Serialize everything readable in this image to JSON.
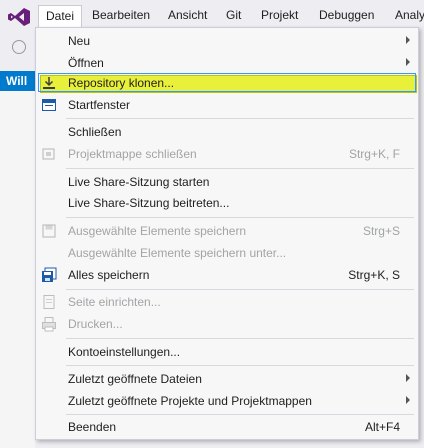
{
  "menubar": {
    "items": [
      "Datei",
      "Bearbeiten",
      "Ansicht",
      "Git",
      "Projekt",
      "Debuggen",
      "Analy"
    ]
  },
  "background": {
    "left_label": "Will"
  },
  "dropdown": {
    "items": [
      {
        "label": "Neu",
        "submenu": true
      },
      {
        "label": "Öffnen",
        "submenu": true
      },
      {
        "label": "Repository klonen...",
        "icon": "clone-repository-icon",
        "highlighted": true
      },
      {
        "label": "Startfenster",
        "icon": "start-window-icon"
      },
      {
        "label": "Schließen"
      },
      {
        "label": "Projektmappe schließen",
        "shortcut": "Strg+K, F",
        "disabled": true,
        "icon": "close-solution-icon"
      },
      {
        "label": "Live Share-Sitzung starten"
      },
      {
        "label": "Live Share-Sitzung beitreten..."
      },
      {
        "label": "Ausgewählte Elemente speichern",
        "shortcut": "Strg+S",
        "disabled": true,
        "icon": "save-icon"
      },
      {
        "label": "Ausgewählte Elemente speichern unter...",
        "disabled": true
      },
      {
        "label": "Alles speichern",
        "shortcut": "Strg+K, S",
        "icon": "save-all-icon"
      },
      {
        "label": "Seite einrichten...",
        "disabled": true,
        "icon": "page-setup-icon"
      },
      {
        "label": "Drucken...",
        "disabled": true,
        "icon": "print-icon"
      },
      {
        "label": "Kontoeinstellungen..."
      },
      {
        "label": "Zuletzt geöffnete Dateien",
        "submenu": true
      },
      {
        "label": "Zuletzt geöffnete Projekte und Projektmappen",
        "submenu": true
      },
      {
        "label": "Beenden",
        "shortcut": "Alt+F4"
      }
    ]
  },
  "colors": {
    "highlight": "#e9f03a",
    "accent": "#68217a",
    "selection_border": "#3399ff"
  }
}
